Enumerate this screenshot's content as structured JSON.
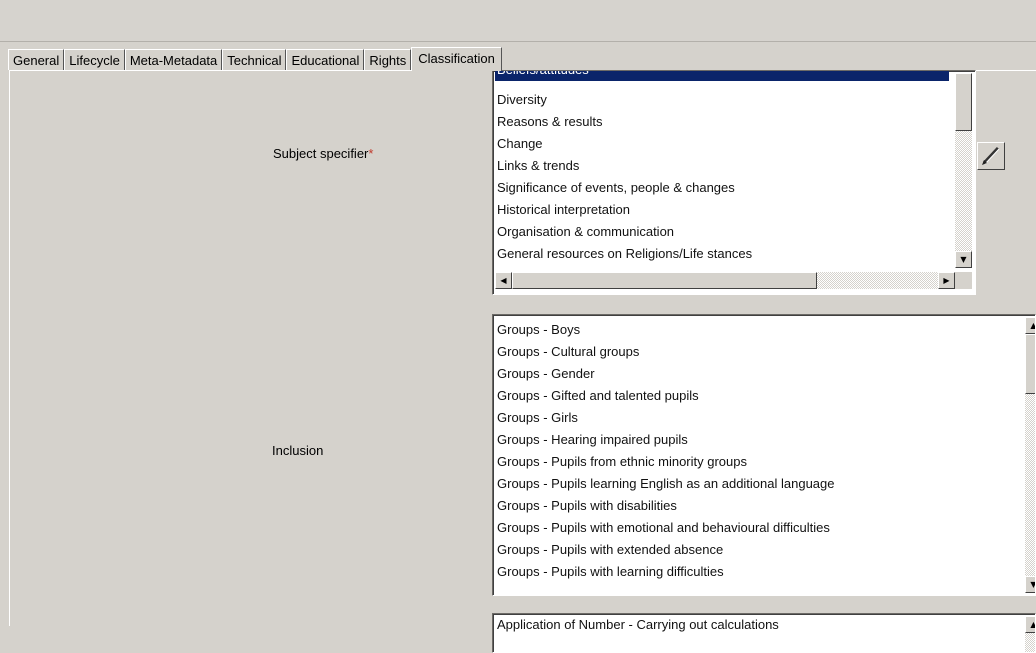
{
  "tabs": [
    {
      "label": "General"
    },
    {
      "label": "Lifecycle"
    },
    {
      "label": "Meta-Metadata"
    },
    {
      "label": "Technical"
    },
    {
      "label": "Educational"
    },
    {
      "label": "Rights"
    },
    {
      "label": "Classification"
    }
  ],
  "active_tab": "Classification",
  "subject_specifier": {
    "label": "Subject specifier",
    "required_marker": "*",
    "items": [
      "Beliefs/attitudes",
      "Diversity",
      "Reasons & results",
      "Change",
      "Links & trends",
      "Significance of events, people & changes",
      "Historical interpretation",
      "Organisation & communication",
      "General resources on Religions/Life stances"
    ],
    "edit_icon": "pencil-icon"
  },
  "inclusion": {
    "label": "Inclusion",
    "items": [
      "Groups - Boys",
      "Groups - Cultural groups",
      "Groups - Gender",
      "Groups - Gifted and talented pupils",
      "Groups - Girls",
      "Groups - Hearing impaired pupils",
      "Groups - Pupils from ethnic minority groups",
      "Groups - Pupils learning English as an additional language",
      "Groups - Pupils with disabilities",
      "Groups - Pupils with emotional and behavioural difficulties",
      "Groups - Pupils with extended absence",
      "Groups - Pupils with learning difficulties"
    ]
  },
  "third_list": {
    "items": [
      "Application of Number - Carrying out calculations"
    ]
  },
  "colors": {
    "selection": "#0a246a",
    "face": "#d5d2cc",
    "required": "#c0392b"
  }
}
